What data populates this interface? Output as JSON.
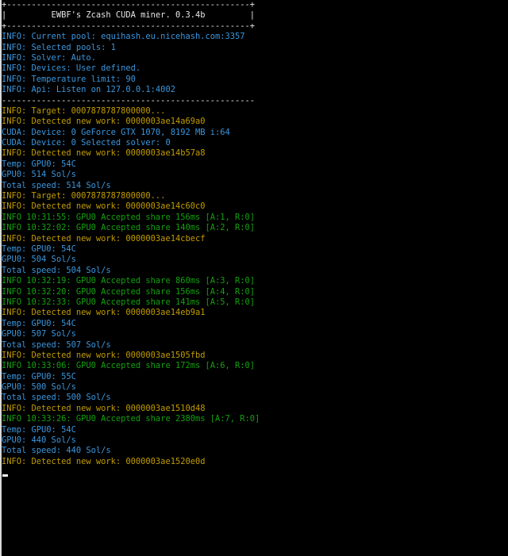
{
  "window": {
    "background": "#000000"
  },
  "colors": {
    "white": "#e6e6e6",
    "cyan": "#3a96dd",
    "yellow": "#c19c00",
    "green": "#13a10e"
  },
  "console_lines": [
    {
      "text": "+-------------------------------------------------+",
      "color": "white"
    },
    {
      "text": "|         EWBF's Zcash CUDA miner. 0.3.4b         |",
      "color": "white"
    },
    {
      "text": "+-------------------------------------------------+",
      "color": "white"
    },
    {
      "text": "INFO: Current pool: equihash.eu.nicehash.com:3357",
      "color": "cyan"
    },
    {
      "text": "INFO: Selected pools: 1",
      "color": "cyan"
    },
    {
      "text": "INFO: Solver: Auto.",
      "color": "cyan"
    },
    {
      "text": "INFO: Devices: User defined.",
      "color": "cyan"
    },
    {
      "text": "INFO: Temperature limit: 90",
      "color": "cyan"
    },
    {
      "text": "INFO: Api: Listen on 127.0.0.1:4002",
      "color": "cyan"
    },
    {
      "text": "---------------------------------------------------",
      "color": "white"
    },
    {
      "text": "INFO: Target: 0007878787800000...",
      "color": "yellow"
    },
    {
      "text": "INFO: Detected new work: 0000003ae14a69a0",
      "color": "yellow"
    },
    {
      "text": "CUDA: Device: 0 GeForce GTX 1070, 8192 MB i:64",
      "color": "cyan"
    },
    {
      "text": "CUDA: Device: 0 Selected solver: 0",
      "color": "cyan"
    },
    {
      "text": "INFO: Detected new work: 0000003ae14b57a8",
      "color": "yellow"
    },
    {
      "text": "Temp: GPU0: 54C",
      "color": "cyan"
    },
    {
      "text": "GPU0: 514 Sol/s",
      "color": "cyan"
    },
    {
      "text": "Total speed: 514 Sol/s",
      "color": "cyan"
    },
    {
      "text": "INFO: Target: 0007878787800000...",
      "color": "yellow"
    },
    {
      "text": "INFO: Detected new work: 0000003ae14c60c0",
      "color": "yellow"
    },
    {
      "text": "INFO 10:31:55: GPU0 Accepted share 156ms [A:1, R:0]",
      "color": "green"
    },
    {
      "text": "INFO 10:32:02: GPU0 Accepted share 140ms [A:2, R:0]",
      "color": "green"
    },
    {
      "text": "INFO: Detected new work: 0000003ae14cbecf",
      "color": "yellow"
    },
    {
      "text": "Temp: GPU0: 54C",
      "color": "cyan"
    },
    {
      "text": "GPU0: 504 Sol/s",
      "color": "cyan"
    },
    {
      "text": "Total speed: 504 Sol/s",
      "color": "cyan"
    },
    {
      "text": "INFO 10:32:19: GPU0 Accepted share 860ms [A:3, R:0]",
      "color": "green"
    },
    {
      "text": "INFO 10:32:20: GPU0 Accepted share 156ms [A:4, R:0]",
      "color": "green"
    },
    {
      "text": "INFO 10:32:33: GPU0 Accepted share 141ms [A:5, R:0]",
      "color": "green"
    },
    {
      "text": "INFO: Detected new work: 0000003ae14eb9a1",
      "color": "yellow"
    },
    {
      "text": "Temp: GPU0: 54C",
      "color": "cyan"
    },
    {
      "text": "GPU0: 507 Sol/s",
      "color": "cyan"
    },
    {
      "text": "Total speed: 507 Sol/s",
      "color": "cyan"
    },
    {
      "text": "INFO: Detected new work: 0000003ae1505fbd",
      "color": "yellow"
    },
    {
      "text": "INFO 10:33:06: GPU0 Accepted share 172ms [A:6, R:0]",
      "color": "green"
    },
    {
      "text": "Temp: GPU0: 55C",
      "color": "cyan"
    },
    {
      "text": "GPU0: 500 Sol/s",
      "color": "cyan"
    },
    {
      "text": "Total speed: 500 Sol/s",
      "color": "cyan"
    },
    {
      "text": "INFO: Detected new work: 0000003ae1510d48",
      "color": "yellow"
    },
    {
      "text": "INFO 10:33:26: GPU0 Accepted share 2380ms [A:7, R:0]",
      "color": "green"
    },
    {
      "text": "Temp: GPU0: 54C",
      "color": "cyan"
    },
    {
      "text": "GPU0: 440 Sol/s",
      "color": "cyan"
    },
    {
      "text": "Total speed: 440 Sol/s",
      "color": "cyan"
    },
    {
      "text": "INFO: Detected new work: 0000003ae1520e0d",
      "color": "yellow"
    }
  ]
}
